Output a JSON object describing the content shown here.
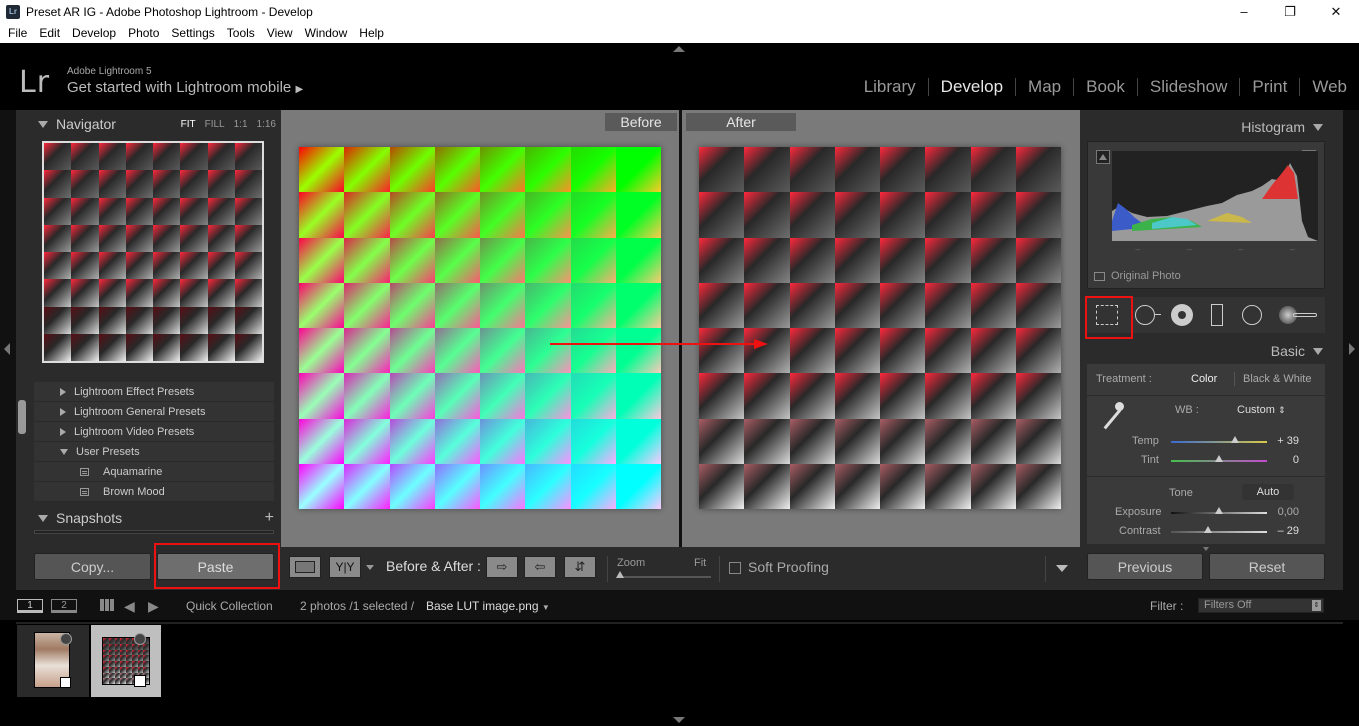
{
  "window": {
    "title": "Preset AR IG - Adobe Photoshop Lightroom - Develop",
    "icon": "Lr",
    "controls": [
      "–",
      "❐",
      "✕"
    ]
  },
  "menu": [
    "File",
    "Edit",
    "Develop",
    "Photo",
    "Settings",
    "Tools",
    "View",
    "Window",
    "Help"
  ],
  "header": {
    "logo": "Lr",
    "version": "Adobe Lightroom 5",
    "mobile": "Get started with Lightroom mobile",
    "modules": [
      "Library",
      "Develop",
      "Map",
      "Book",
      "Slideshow",
      "Print",
      "Web"
    ],
    "active_module": "Develop"
  },
  "navigator": {
    "title": "Navigator",
    "zoom_options": [
      "FIT",
      "FILL",
      "1:1",
      "1:16"
    ],
    "active_zoom": "FIT"
  },
  "presets": [
    {
      "label": "Lightroom Effect Presets",
      "level": 0,
      "expanded": false
    },
    {
      "label": "Lightroom General Presets",
      "level": 0,
      "expanded": false
    },
    {
      "label": "Lightroom Video Presets",
      "level": 0,
      "expanded": false
    },
    {
      "label": "User Presets",
      "level": 0,
      "expanded": true
    },
    {
      "label": "Aquamarine",
      "level": 1
    },
    {
      "label": "Brown Mood",
      "level": 1
    }
  ],
  "snapshots": {
    "title": "Snapshots",
    "add": "+"
  },
  "left_buttons": {
    "copy": "Copy...",
    "paste": "Paste"
  },
  "view": {
    "before_label": "Before",
    "after_label": "After"
  },
  "toolbar": {
    "yy": "Y|Y",
    "before_after": "Before & After :",
    "zoom": "Zoom",
    "fit": "Fit",
    "soft_proofing": "Soft Proofing"
  },
  "histogram": {
    "title": "Histogram",
    "original_photo": "Original Photo"
  },
  "basic": {
    "title": "Basic",
    "treatment_label": "Treatment :",
    "treatment_color": "Color",
    "treatment_bw": "Black & White",
    "wb_label": "WB :",
    "wb_value": "Custom",
    "temp_label": "Temp",
    "temp_value": "+ 39",
    "tint_label": "Tint",
    "tint_value": "0",
    "tone_label": "Tone",
    "auto_label": "Auto",
    "exposure_label": "Exposure",
    "exposure_value": "0,00",
    "contrast_label": "Contrast",
    "contrast_value": "– 29"
  },
  "right_buttons": {
    "previous": "Previous",
    "reset": "Reset"
  },
  "filmstrip": {
    "view1": "1",
    "view2": "2",
    "source": "Quick Collection",
    "count": "2 photos /1 selected /",
    "filename": "Base LUT image.png",
    "filter_label": "Filter :",
    "filter_value": "Filters Off"
  },
  "colors": {
    "highlight_red": "#e11111",
    "panel_bg": "#2b2b2b",
    "canvas_bg": "#7a7a7a"
  }
}
